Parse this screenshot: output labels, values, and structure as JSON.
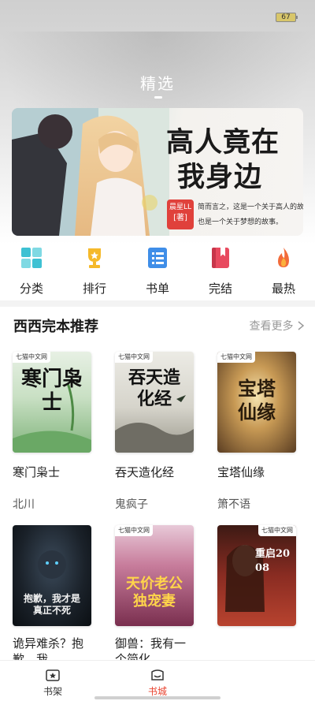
{
  "status": {
    "battery": "67"
  },
  "header": {
    "title": "精选"
  },
  "banner": {
    "title_line1": "高人竟在",
    "title_line2": "我身边",
    "author_name": "晨星LL",
    "author_tag": "[著]",
    "desc_line1": "简而言之，这是一个关于高人的故事。",
    "desc_line2": "也是一个关于梦想的故事。"
  },
  "categories": [
    {
      "label": "分类",
      "icon": "grid-icon",
      "color": "#3ec1d3"
    },
    {
      "label": "排行",
      "icon": "trophy-icon",
      "color": "#f5b92a"
    },
    {
      "label": "书单",
      "icon": "list-icon",
      "color": "#3f8ee8"
    },
    {
      "label": "完结",
      "icon": "bookmark-book-icon",
      "color": "#e84a5f"
    },
    {
      "label": "最热",
      "icon": "flame-icon",
      "color": "#f26b3a"
    }
  ],
  "section": {
    "title": "西西完本推荐",
    "more": "查看更多",
    "more_icon": "chevron-right-icon"
  },
  "books": [
    {
      "name": "寒门枭士",
      "author": "北川",
      "cover_title": "寒门枭士",
      "badge": "七猫中文网"
    },
    {
      "name": "吞天造化经",
      "author": "鬼疯子",
      "cover_title": "吞天造化经",
      "badge": "七猫中文网"
    },
    {
      "name": "宝塔仙缘",
      "author": "箫不语",
      "cover_title": "宝塔仙缘",
      "badge": "七猫中文网"
    },
    {
      "name": "诡异难杀？抱歉，我…",
      "cover_title": "抱歉，我才是真正不死",
      "badge": ""
    },
    {
      "name": "御兽：我有一个简化…",
      "cover_title": "天价老公独宠妻",
      "badge": "七猫中文网"
    },
    {
      "name": "",
      "cover_title": "重启2008",
      "badge": "七猫中文网"
    }
  ],
  "nav": [
    {
      "label": "书架",
      "icon": "bookshelf-icon"
    },
    {
      "label": "书城",
      "icon": "store-icon"
    }
  ],
  "colors": {
    "accent": "#e8432f",
    "banner_author_bg": "#e0413b"
  }
}
